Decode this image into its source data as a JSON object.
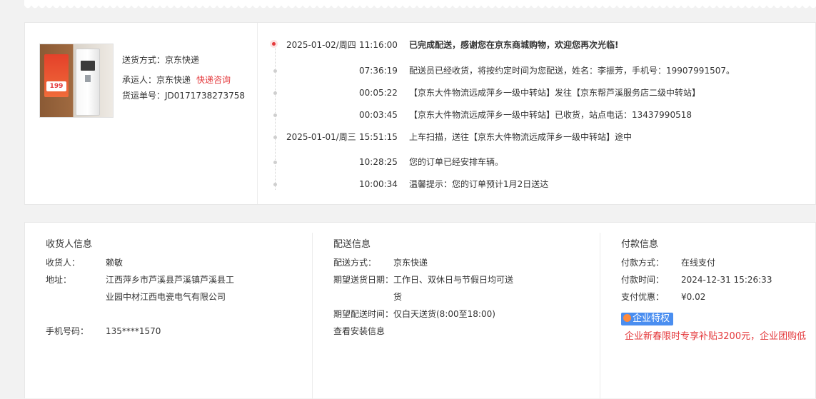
{
  "shipping": {
    "method_label": "送货方式：",
    "method_value": "京东快递",
    "carrier_label": "承运人：",
    "carrier_value": "京东快递",
    "carrier_link": "快递咨询",
    "waybill_label": "货运单号：",
    "waybill_value": "JD0171738273758",
    "product_price": "199"
  },
  "timeline": [
    {
      "date": "2025-01-02/周四",
      "time": "11:16:00",
      "text": "已完成配送，感谢您在京东商城购物，欢迎您再次光临!",
      "bold": true
    },
    {
      "date": "",
      "time": "07:36:19",
      "text": "配送员已经收货，将按约定时间为您配送，姓名：李振芳，手机号：19907991507。"
    },
    {
      "date": "",
      "time": "00:05:22",
      "text": "【京东大件物流远成萍乡一级中转站】发往【京东帮芦溪服务店二级中转站】"
    },
    {
      "date": "",
      "time": "00:03:45",
      "text": "【京东大件物流远成萍乡一级中转站】已收货，站点电话：13437990518"
    },
    {
      "date": "2025-01-01/周三",
      "time": "15:51:15",
      "text": "上车扫描，送往【京东大件物流远成萍乡一级中转站】途中"
    },
    {
      "date": "",
      "time": "10:28:25",
      "text": "您的订单已经安排车辆。"
    },
    {
      "date": "",
      "time": "10:00:34",
      "text": "温馨提示：您的订单预计1月2日送达"
    }
  ],
  "receiver": {
    "title": "收货人信息",
    "name_label": "收货人：",
    "name_value": "赖敏",
    "address_label": "地址：",
    "address_value": "江西萍乡市芦溪县芦溪镇芦溪县工业园中材江西电瓷电气有限公司",
    "phone_label": "手机号码：",
    "phone_value": "135****1570"
  },
  "delivery": {
    "title": "配送信息",
    "method_label": "配送方式：",
    "method_value": "京东快递",
    "date_label": "期望送货日期：",
    "date_value": "工作日、双休日与节假日均可送货",
    "time_label": "期望配送时间：",
    "time_value": "仅白天送货(8:00至18:00)",
    "install_link": "查看安装信息"
  },
  "payment": {
    "title": "付款信息",
    "method_label": "付款方式：",
    "method_value": "在线支付",
    "time_label": "付款时间：",
    "time_value": "2024-12-31 15:26:33",
    "discount_label": "支付优惠：",
    "discount_value": "¥0.02",
    "badge_text": "企业特权",
    "promo_text": "企业新春限时专享补贴3200元，企业团购低"
  },
  "colors": {
    "accent": "#e4393c",
    "badge": "#4a8ef0"
  }
}
